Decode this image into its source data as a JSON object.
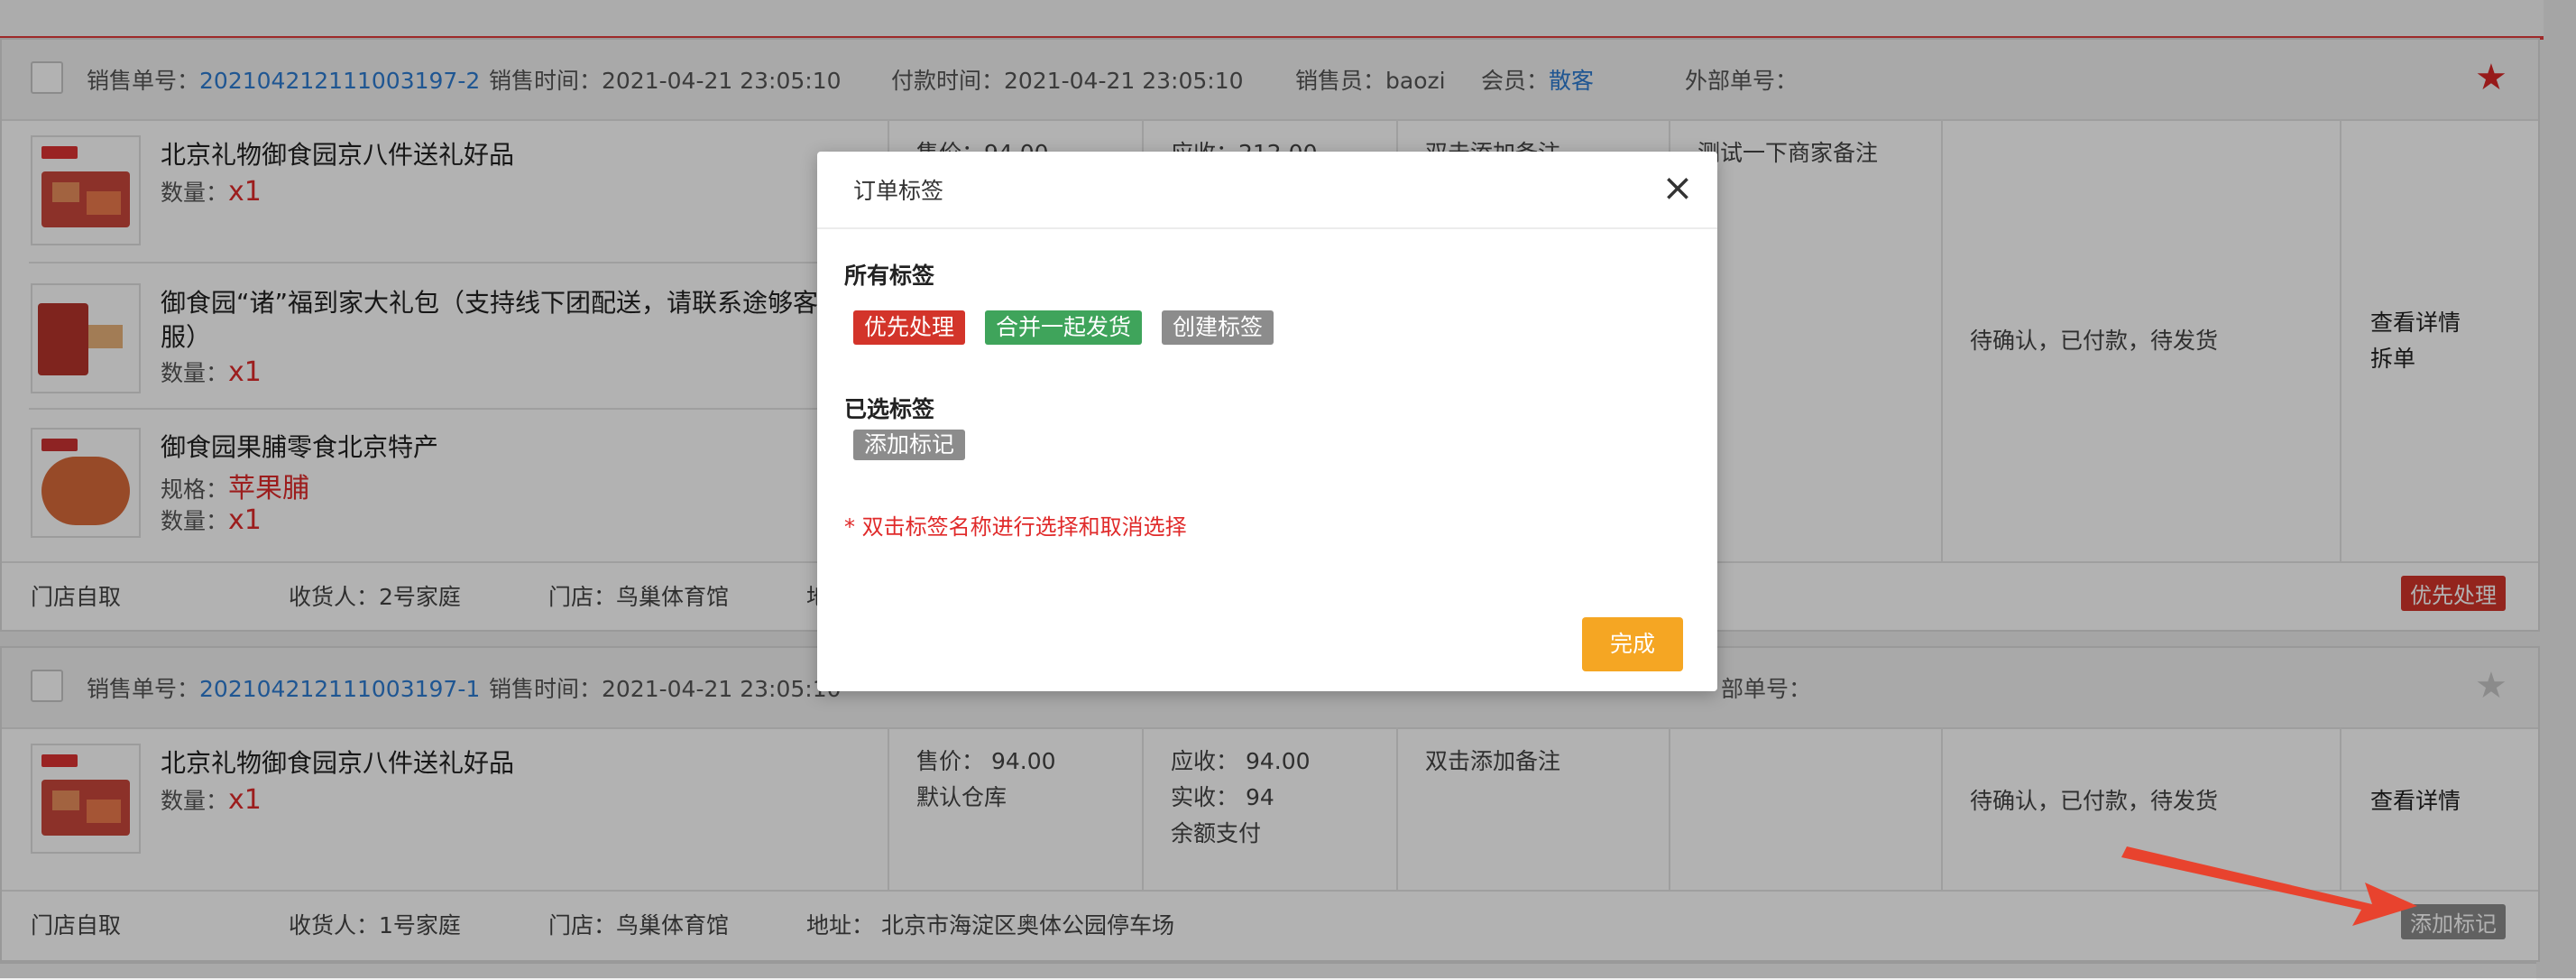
{
  "colors": {
    "accent_red": "#e02a2a",
    "link_blue": "#2d7bd2",
    "tag_red": "#d3342a",
    "tag_green": "#3fa45b",
    "tag_grey": "#8c8c8c",
    "done_orange": "#f5a623",
    "star_red": "#d82626",
    "star_grey": "#c8c8c8"
  },
  "order1": {
    "no_label": "销售单号：",
    "no": "202104212111003197-2",
    "sale_time": "销售时间：2021-04-21 23:05:10",
    "pay_time": "付款时间：2021-04-21 23:05:10",
    "seller": "销售员：baozi",
    "member_label": "会员：",
    "member": "散客",
    "external": "外部单号：",
    "star_icon": "star-filled",
    "items": [
      {
        "name": "北京礼物御食园京八件送礼好品",
        "qty_label": "数量：",
        "qty": "x1"
      },
      {
        "name": "御食园“诸”福到家大礼包（支持线下团配送，请联系途够客",
        "name2": "服）",
        "qty_label": "数量：",
        "qty": "x1"
      },
      {
        "name": "御食园果脯零食北京特产",
        "spec_label": "规格：",
        "spec": "苹果脯",
        "qty_label": "数量：",
        "qty": "x1"
      }
    ],
    "price_partial": "售价：94.00",
    "receivable_partial": "应收：212.00",
    "remark": "双击添加备注",
    "merchant_remark": "测试一下商家备注",
    "status": "待确认，已付款，待发货",
    "action_detail": "查看详情",
    "action_split": "拆单",
    "foot": {
      "delivery": "门店自取",
      "receiver": "收货人：2号家庭",
      "store": "门店：鸟巢体育馆",
      "addr_partial": "地址"
    },
    "tag": "优先处理"
  },
  "order2": {
    "no_label": "销售单号：",
    "no": "202104212111003197-1",
    "sale_time": "销售时间：2021-04-21 23:05:10",
    "external_partial": "部单号：",
    "star_icon": "star-outline",
    "item": {
      "name": "北京礼物御食园京八件送礼好品",
      "qty_label": "数量：",
      "qty": "x1"
    },
    "price": "售价：  94.00",
    "warehouse": "默认仓库",
    "receivable": "应收：  94.00",
    "received": "实收：  94",
    "pay_method": "余额支付",
    "remark": "双击添加备注",
    "status": "待确认，已付款，待发货",
    "action_detail": "查看详情",
    "foot": {
      "delivery": "门店自取",
      "receiver": "收货人：1号家庭",
      "store": "门店：鸟巢体育馆",
      "addr": "地址：  北京市海淀区奥体公园停车场"
    },
    "tag": "添加标记"
  },
  "modal": {
    "title": "订单标签",
    "close_icon": "close-icon",
    "all_tags_title": "所有标签",
    "all_tags": [
      {
        "label": "优先处理",
        "color": "#d3342a"
      },
      {
        "label": "合并一起发货",
        "color": "#3fa45b"
      },
      {
        "label": "创建标签",
        "color": "#8c8c8c"
      }
    ],
    "selected_title": "已选标签",
    "selected_tags": [
      {
        "label": "添加标记",
        "color": "#8c8c8c"
      }
    ],
    "hint": "* 双击标签名称进行选择和取消选择",
    "done": "完成"
  }
}
